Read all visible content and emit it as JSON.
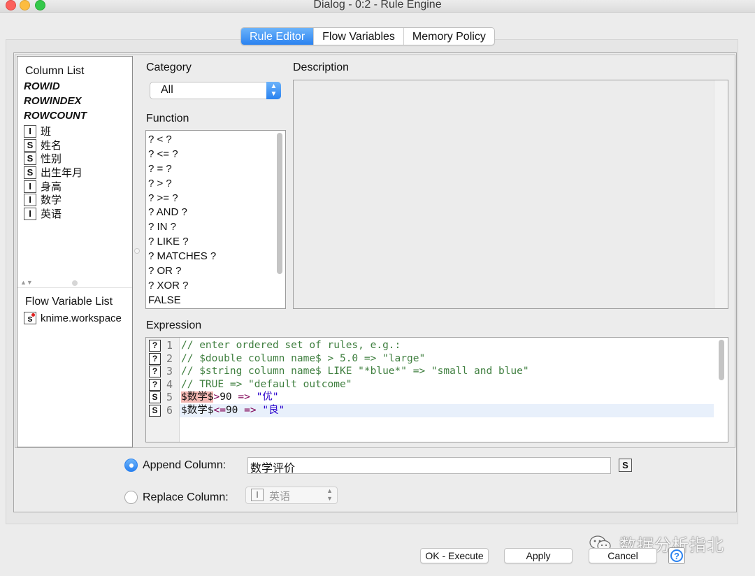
{
  "window": {
    "title": "Dialog - 0:2 - Rule Engine"
  },
  "tabs": [
    {
      "label": "Rule Editor",
      "active": true
    },
    {
      "label": "Flow Variables",
      "active": false
    },
    {
      "label": "Memory Policy",
      "active": false
    }
  ],
  "column_list": {
    "heading": "Column List",
    "special": [
      "ROWID",
      "ROWINDEX",
      "ROWCOUNT"
    ],
    "columns": [
      {
        "type": "I",
        "name": "班"
      },
      {
        "type": "S",
        "name": "姓名"
      },
      {
        "type": "S",
        "name": "性别"
      },
      {
        "type": "S",
        "name": "出生年月"
      },
      {
        "type": "I",
        "name": "身高"
      },
      {
        "type": "I",
        "name": "数学"
      },
      {
        "type": "I",
        "name": "英语"
      }
    ]
  },
  "flow_variable_list": {
    "heading": "Flow Variable List",
    "items": [
      {
        "type": "s",
        "name": "knime.workspace"
      }
    ]
  },
  "category": {
    "label": "Category",
    "value": "All"
  },
  "function": {
    "label": "Function",
    "items": [
      "? < ?",
      "? <= ?",
      "? = ?",
      "? > ?",
      "? >= ?",
      "? AND ?",
      "? IN ?",
      "? LIKE ?",
      "? MATCHES ?",
      "? OR ?",
      "? XOR ?",
      "FALSE"
    ]
  },
  "description": {
    "label": "Description"
  },
  "expression": {
    "label": "Expression",
    "lines": [
      {
        "num": "1",
        "marker": "?",
        "text": "// enter ordered set of rules, e.g.:"
      },
      {
        "num": "2",
        "marker": "?",
        "text": "// $double column name$ > 5.0 => \"large\""
      },
      {
        "num": "3",
        "marker": "?",
        "text": "// $string column name$ LIKE \"*blue*\" => \"small and blue\""
      },
      {
        "num": "4",
        "marker": "?",
        "text": "// TRUE => \"default outcome\""
      },
      {
        "num": "5",
        "marker": "S",
        "col": "$数学$",
        "op1": ">",
        "val": "90",
        "arrow": "=>",
        "result": "\"优\""
      },
      {
        "num": "6",
        "marker": "S",
        "col": "$数学$",
        "op1": "<=",
        "val": "90",
        "arrow": "=>",
        "result": "\"良\""
      }
    ]
  },
  "output": {
    "append_label": "Append Column:",
    "append_value": "数学评价",
    "append_type": "S",
    "replace_label": "Replace Column:",
    "replace_type": "I",
    "replace_value": "英语"
  },
  "buttons": {
    "ok": "OK - Execute",
    "apply": "Apply",
    "cancel": "Cancel",
    "help": "?"
  },
  "watermark": {
    "text": "数据分析指北"
  },
  "colors": {
    "accent": "#2a82f0",
    "comment": "#3f7f3f",
    "string": "#2a00cc",
    "keyword": "#7f0055",
    "highlight": "#f2b7b2"
  }
}
